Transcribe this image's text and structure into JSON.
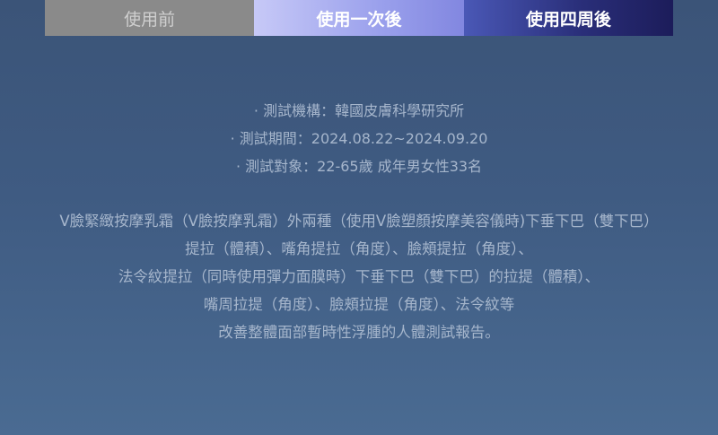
{
  "tabs": [
    {
      "label": "使用前",
      "state": "inactive"
    },
    {
      "label": "使用一次後",
      "state": "active"
    },
    {
      "label": "使用四周後",
      "state": "active"
    }
  ],
  "test_info": [
    "· 測試機構：韓國皮膚科學研究所",
    "· 測試期間：2024.08.22~2024.09.20",
    "· 測試對象：22-65歲 成年男女性33名"
  ],
  "description": [
    "V臉緊緻按摩乳霜（V臉按摩乳霜）外兩種（使用V臉塑顏按摩美容儀時)下垂下巴（雙下巴）",
    "提拉（體積）、嘴角提拉（角度）、臉頰提拉（角度）、",
    "法令紋提拉（同時使用彈力面膜時）下垂下巴（雙下巴）的拉提（體積）、",
    "嘴周拉提（角度）、臉頰拉提（角度）、法令紋等",
    "改善整體面部暫時性浮腫的人體測試報告。"
  ],
  "colors": {
    "background": "#3f5b82",
    "text": "#a6b6cc",
    "tab_before": "#8a8a8a",
    "tab_once": "#9aa0ec",
    "tab_four_weeks": "#1c1c5a"
  }
}
